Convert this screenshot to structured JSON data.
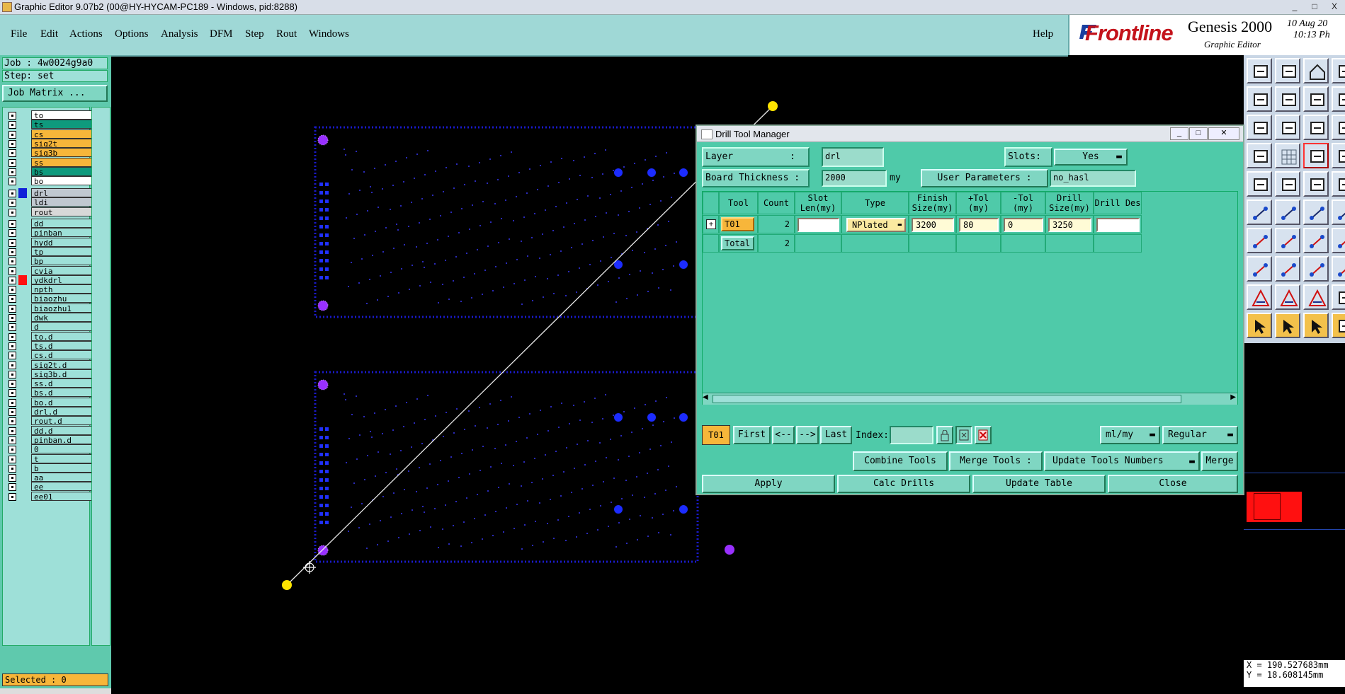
{
  "window": {
    "title": "Graphic Editor 9.07b2 (00@HY-HYCAM-PC189 - Windows, pid:8288)",
    "controls": [
      "_",
      "□",
      "X"
    ]
  },
  "menu": {
    "file": "File",
    "edit": "Edit",
    "actions": "Actions",
    "options": "Options",
    "analysis": "Analysis",
    "dfm": "DFM",
    "step": "Step",
    "rout": "Rout",
    "windows": "Windows",
    "help": "Help"
  },
  "logo": {
    "brand": "Frontline",
    "product": "Genesis 2000",
    "subtitle": "Graphic Editor",
    "date": "10 Aug 20",
    "time": "10:13 Ph"
  },
  "left": {
    "job": "Job : 4w0024g9a0",
    "step": "Step: set",
    "job_matrix": "Job Matrix ...",
    "selected": "Selected : 0",
    "layers_group1": [
      {
        "name": "to",
        "color": "#ffffff"
      },
      {
        "name": "ts",
        "color": "#0f9a7d"
      },
      {
        "name": "cs",
        "color": "#f7b63a"
      },
      {
        "name": "sig2t",
        "color": "#f7b63a"
      },
      {
        "name": "sig3b",
        "color": "#f7b63a"
      },
      {
        "name": "ss",
        "color": "#f7b63a"
      },
      {
        "name": "bs",
        "color": "#0f9a7d"
      },
      {
        "name": "bo",
        "color": "#ffffff"
      }
    ],
    "layers_group2": [
      {
        "name": "drl",
        "color": "#c0c8d0",
        "mark": "#1020d8"
      },
      {
        "name": "ldi",
        "color": "#c0c8d0"
      },
      {
        "name": "rout",
        "color": "#d8d8d8"
      }
    ],
    "layers_group3": [
      {
        "name": "dd"
      },
      {
        "name": "pinban"
      },
      {
        "name": "hydd"
      },
      {
        "name": "tp"
      },
      {
        "name": "bp"
      },
      {
        "name": "cvia"
      },
      {
        "name": "ydkdrl",
        "mark": "#ff1010"
      },
      {
        "name": "npth"
      },
      {
        "name": "biaozhu"
      },
      {
        "name": "biaozhu1",
        "flag": true
      },
      {
        "name": "dwk"
      },
      {
        "name": "d"
      },
      {
        "name": "to.d",
        "flag": true
      },
      {
        "name": "ts.d"
      },
      {
        "name": "cs.d"
      },
      {
        "name": "sig2t.d"
      },
      {
        "name": "sig3b.d"
      },
      {
        "name": "ss.d"
      },
      {
        "name": "bs.d"
      },
      {
        "name": "bo.d"
      },
      {
        "name": "drl.d"
      },
      {
        "name": "rout.d"
      },
      {
        "name": "dd.d",
        "flag": true
      },
      {
        "name": "pinban.d",
        "flag": true
      },
      {
        "name": "0"
      },
      {
        "name": "t"
      },
      {
        "name": "b"
      },
      {
        "name": "aa"
      },
      {
        "name": "ee"
      },
      {
        "name": "ee01"
      }
    ]
  },
  "dialog": {
    "title": "Drill Tool Manager",
    "layer_label": "Layer",
    "layer_sep": ":",
    "layer_value": "drl",
    "slots_label": "Slots:",
    "slots_value": "Yes",
    "board_thickness_label": "Board Thickness :",
    "board_thickness_value": "2000",
    "board_thickness_unit": "my",
    "user_params_label": "User Parameters :",
    "user_params_value": "no_hasl",
    "columns": [
      "Tool",
      "Count",
      "Slot Len(my)",
      "Type",
      "Finish Size(my)",
      "+Tol (my)",
      "-Tol (my)",
      "Drill Size(my)",
      "Drill Des"
    ],
    "rows": [
      {
        "tool": "T01",
        "count": "2",
        "slot_len": "",
        "type": "NPlated",
        "finish": "3200",
        "plus_tol": "80",
        "minus_tol": "0",
        "drill": "3250",
        "des": ""
      }
    ],
    "total_label": "Total",
    "total_count": "2",
    "nav": {
      "current": "T01",
      "first": "First",
      "prev": "<--",
      "next": "-->",
      "last": "Last",
      "index_label": "Index:",
      "units": "ml/my",
      "mode": "Regular"
    },
    "actions": {
      "combine": "Combine Tools",
      "merge_tools": "Merge Tools :",
      "update_numbers": "Update Tools Numbers",
      "merge": "Merge",
      "apply": "Apply",
      "calc": "Calc Drills",
      "update_table": "Update Table",
      "close": "Close"
    }
  },
  "status": {
    "x": "X = 190.527683mm",
    "y": "Y = 18.608145mm"
  }
}
